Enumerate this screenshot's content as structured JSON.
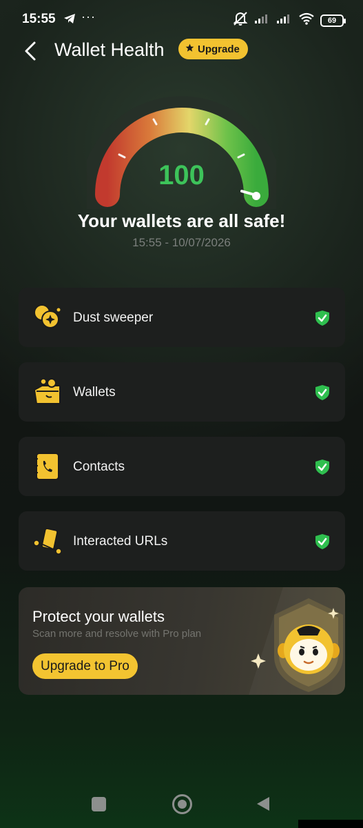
{
  "status": {
    "time": "15:55",
    "more": "···",
    "battery": "69"
  },
  "header": {
    "title": "Wallet Health",
    "upgrade_label": "Upgrade"
  },
  "gauge": {
    "score": "100",
    "level": 1.0
  },
  "summary": {
    "message": "Your wallets are all safe!",
    "timestamp": "15:55 - 10/07/2026"
  },
  "checks": [
    {
      "label": "Dust sweeper",
      "icon": "coins-icon",
      "status": "safe"
    },
    {
      "label": "Wallets",
      "icon": "wallet-folder-icon",
      "status": "safe"
    },
    {
      "label": "Contacts",
      "icon": "contact-book-icon",
      "status": "safe"
    },
    {
      "label": "Interacted URLs",
      "icon": "link-card-icon",
      "status": "safe"
    }
  ],
  "promo": {
    "title": "Protect your wallets",
    "subtitle": "Scan more and resolve with Pro plan",
    "button": "Upgrade to Pro"
  },
  "colors": {
    "accent": "#f2c230",
    "score": "#3dc35a",
    "safe_check": "#2fbf4f",
    "card_bg": "#1d1f1e"
  }
}
